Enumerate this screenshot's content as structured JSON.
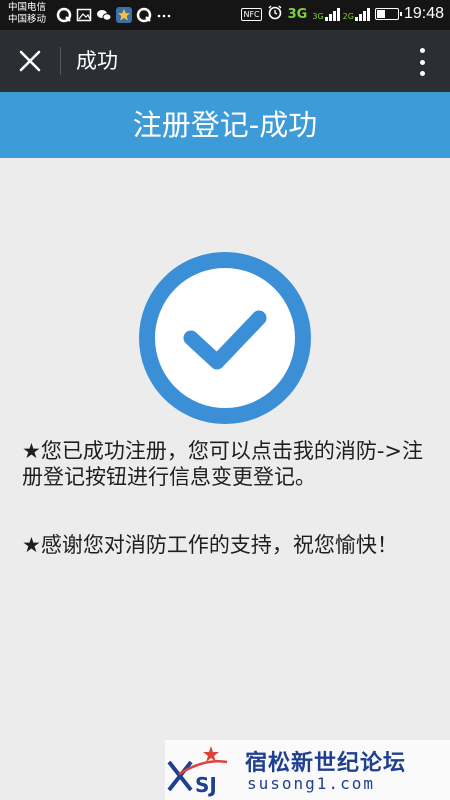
{
  "status_bar": {
    "carrier_1": "中国电信",
    "carrier_2": "中国移动",
    "nfc": "NFC",
    "net_3g": "3G",
    "net_3g_small": "3G",
    "net_2g_small": "2G",
    "time": "19:48",
    "battery_level": 0.45,
    "icons": [
      "q-icon",
      "image-icon",
      "wechat-icon",
      "star-app-icon",
      "q-icon",
      "more-icon",
      "alarm-icon",
      "signal-icon",
      "battery-icon"
    ]
  },
  "titlebar": {
    "title": "成功"
  },
  "header": {
    "title": "注册登记-成功"
  },
  "messages": [
    "★您已成功注册，您可以点击我的消防->注册登记按钮进行信息变更登记。",
    "★感谢您对消防工作的支持，祝您愉快！"
  ],
  "watermark": {
    "name": "宿松新世纪论坛",
    "url": "susong1.com"
  },
  "colors": {
    "accent": "#3d9bd7",
    "check": "#3a8fd6",
    "titlebar": "#2b2f33",
    "background": "#ececec"
  }
}
